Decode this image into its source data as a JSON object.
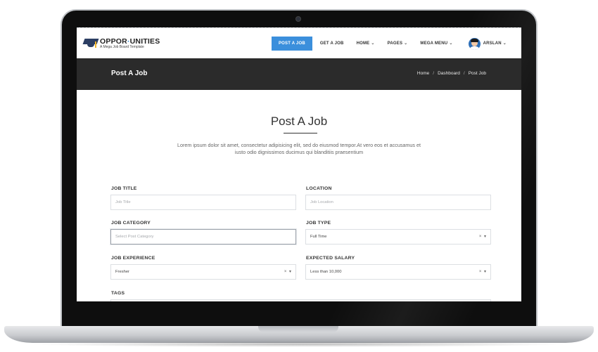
{
  "site": {
    "logo_main_a": "OPPOR",
    "logo_main_b": "UNITIES",
    "logo_sub": "A Mega Job Board Template",
    "accent_color": "#3b8fdc"
  },
  "nav": {
    "items": [
      {
        "label": "POST A JOB",
        "active": true
      },
      {
        "label": "GET A JOB",
        "active": false
      },
      {
        "label": "HOME",
        "dropdown": true
      },
      {
        "label": "PAGES",
        "dropdown": true
      },
      {
        "label": "MEGA MENU",
        "dropdown": true
      }
    ],
    "user_name": "ARSLAN"
  },
  "titlebar": {
    "title": "Post A Job",
    "breadcrumb": [
      "Home",
      "Dashboard",
      "Post Job"
    ],
    "separator": "/"
  },
  "content": {
    "heading": "Post A Job",
    "intro": "Lorem ipsum dolor sit amet, consectetur adipisicing elit, sed do eiusmod tempor.At vero eos et accusamus et iusto odio dignissimos ducimus qui blanditiis praesentium"
  },
  "form": {
    "job_title": {
      "label": "JOB TITLE",
      "placeholder": "Job Title"
    },
    "location": {
      "label": "LOCATION",
      "placeholder": "Job Location"
    },
    "job_category": {
      "label": "JOB CATEGORY",
      "placeholder": "Select Post Category"
    },
    "job_type": {
      "label": "JOB TYPE",
      "value": "Full Time"
    },
    "job_experience": {
      "label": "JOB EXPERIENCE",
      "value": "Fresher"
    },
    "expected_salary": {
      "label": "EXPECTED SALARY",
      "value": "Less than 10,000"
    },
    "tags": {
      "label": "TAGS"
    },
    "select_controls": "× ▾"
  }
}
